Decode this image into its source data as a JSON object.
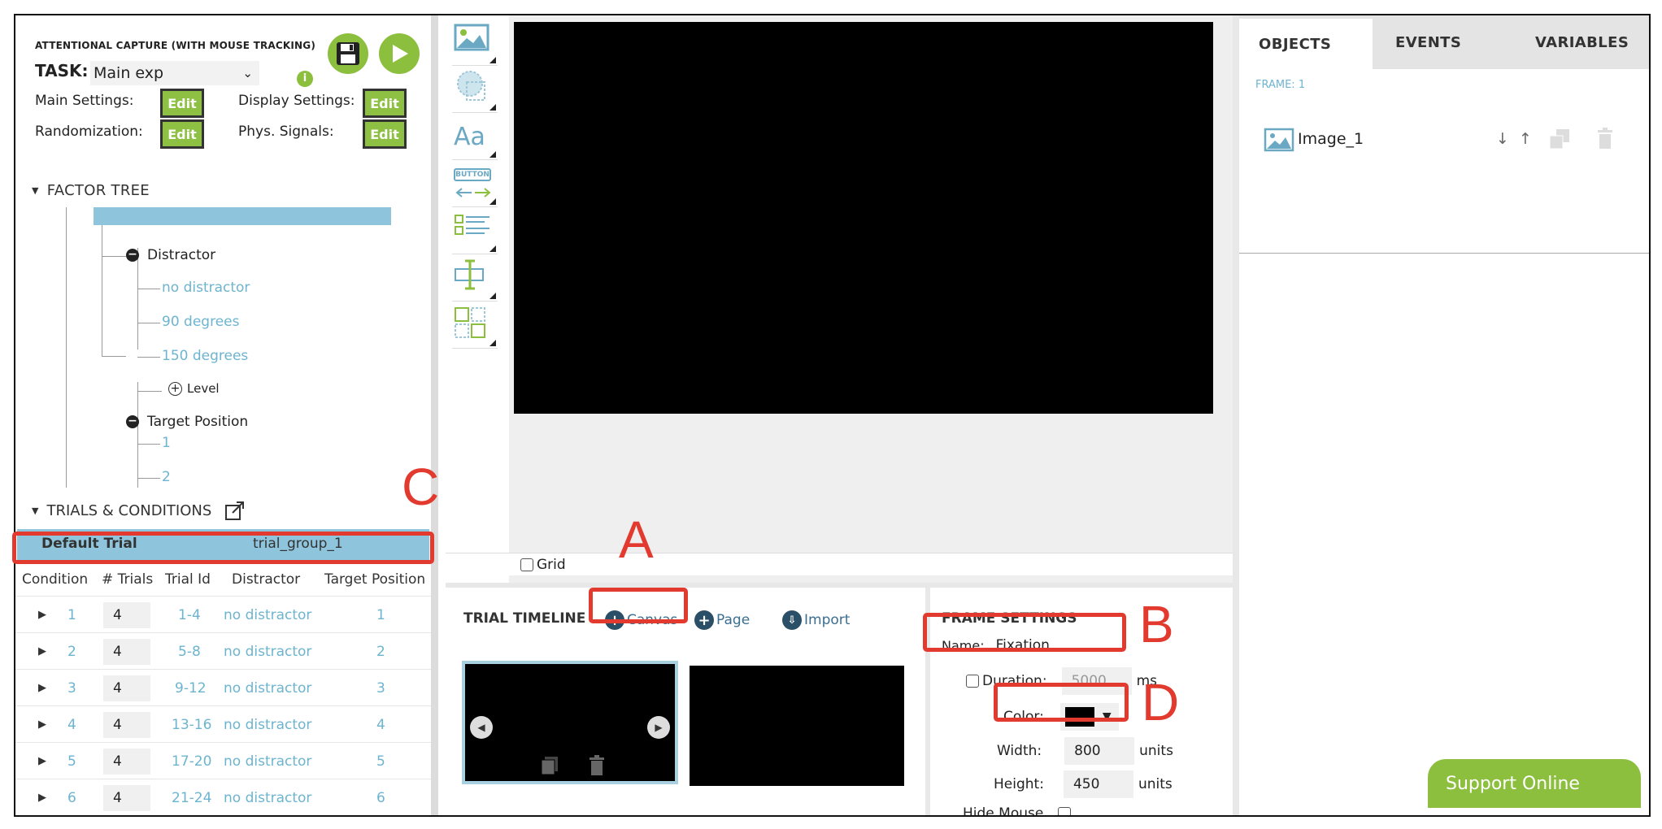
{
  "header": {
    "experiment_title": "ATTENTIONAL CAPTURE (WITH MOUSE TRACKING)",
    "task_label": "TASK:",
    "task_value": "Main exp",
    "info_icon": "i",
    "main_settings_label": "Main Settings:",
    "display_settings_label": "Display Settings:",
    "randomization_label": "Randomization:",
    "phys_signals_label": "Phys. Signals:",
    "edit_label": "Edit"
  },
  "factor_tree": {
    "title": "FACTOR TREE",
    "group_label": "trial_group_1",
    "factors": [
      {
        "name": "Distractor",
        "levels": [
          "no distractor",
          "90 degrees",
          "150 degrees"
        ]
      },
      {
        "name": "Target Position",
        "levels": [
          "1",
          "2"
        ]
      }
    ],
    "add_level_label": "Level"
  },
  "trials": {
    "title": "TRIALS & CONDITIONS",
    "default_trial_label": "Default Trial",
    "default_trial_group": "trial_group_1",
    "columns": [
      "Condition",
      "# Trials",
      "Trial Id",
      "Distractor",
      "Target Position"
    ],
    "rows": [
      {
        "condition": "1",
        "trials": "4",
        "trial_id": "1-4",
        "distractor": "no distractor",
        "target": "1"
      },
      {
        "condition": "2",
        "trials": "4",
        "trial_id": "5-8",
        "distractor": "no distractor",
        "target": "2"
      },
      {
        "condition": "3",
        "trials": "4",
        "trial_id": "9-12",
        "distractor": "no distractor",
        "target": "3"
      },
      {
        "condition": "4",
        "trials": "4",
        "trial_id": "13-16",
        "distractor": "no distractor",
        "target": "4"
      },
      {
        "condition": "5",
        "trials": "4",
        "trial_id": "17-20",
        "distractor": "no distractor",
        "target": "5"
      },
      {
        "condition": "6",
        "trials": "4",
        "trial_id": "21-24",
        "distractor": "no distractor",
        "target": "6"
      }
    ]
  },
  "canvas": {
    "grid_label": "Grid",
    "tools": [
      "image-tool-icon",
      "shape-tool-icon",
      "text-tool-icon",
      "button-tool-icon",
      "list-tool-icon",
      "input-tool-icon",
      "layout-tool-icon"
    ],
    "text_tool_label": "Aa",
    "button_tool_label": "BUTTON"
  },
  "timeline": {
    "title": "TRIAL TIMELINE",
    "canvas_label": "Canvas",
    "page_label": "Page",
    "import_label": "Import"
  },
  "frame_settings": {
    "title": "FRAME SETTINGS",
    "name_label": "Name:",
    "name_value": "Fixation",
    "duration_label": "Duration:",
    "duration_value": "5000",
    "duration_unit": "ms",
    "color_label": "Color:",
    "color_value": "#000000",
    "width_label": "Width:",
    "width_value": "800",
    "height_label": "Height:",
    "height_value": "450",
    "units_label": "units",
    "hide_mouse_label": "Hide Mouse"
  },
  "right_panel": {
    "tabs": [
      "OBJECTS",
      "EVENTS",
      "VARIABLES"
    ],
    "frame_label": "FRAME: 1",
    "objects": [
      {
        "name": "Image_1"
      }
    ]
  },
  "support_label": "Support Online",
  "annotations": {
    "a": "A",
    "b": "B",
    "c": "C",
    "d": "D"
  },
  "colors": {
    "accent_green": "#8dbf3f",
    "highlight_blue": "#8ec5dc",
    "annotation_red": "#e23a2e",
    "link_blue": "#6db4cf"
  }
}
